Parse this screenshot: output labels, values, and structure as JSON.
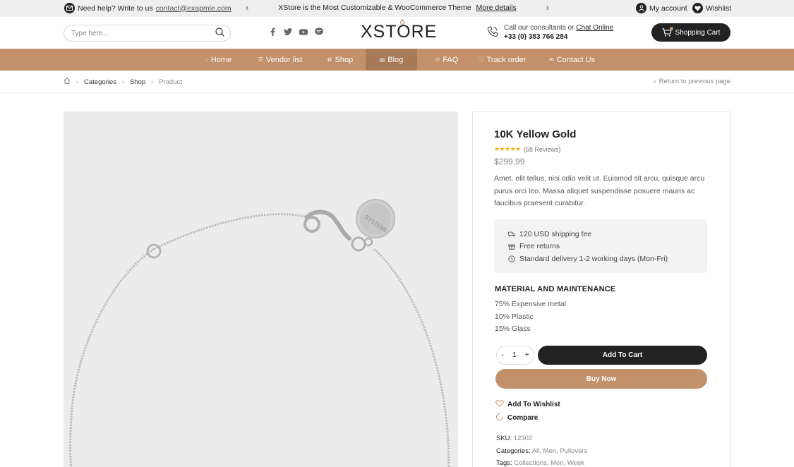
{
  "topbar": {
    "help_text": "Need help? Write to us",
    "help_email": "contact@exapmle.com",
    "promo_text": "XStore is the Most Customizable & WooCommerce Theme",
    "promo_link": "More details",
    "prev_arrow": "‹",
    "next_arrow": "›",
    "account_label": "My account",
    "wishlist_label": "Wishlist"
  },
  "header": {
    "search_placeholder": "Type here...",
    "logo_text": "XSTORE",
    "consult_text": "Call our consultants or",
    "chat_link": "Chat Online",
    "phone": "+33 (0) 383 766 284",
    "cart_label": "Shopping Cart",
    "socials": [
      "facebook-icon",
      "twitter-icon",
      "youtube-icon",
      "line-icon"
    ]
  },
  "nav": {
    "items": [
      {
        "label": "Home",
        "icon": "⌂"
      },
      {
        "label": "Vendor list",
        "icon": "☰"
      },
      {
        "label": "Shop",
        "icon": "✿"
      },
      {
        "label": "Blog",
        "icon": "▤"
      },
      {
        "label": "FAQ",
        "icon": "⊙"
      },
      {
        "label": "Track order",
        "icon": "ⓘ"
      },
      {
        "label": "Contact Us",
        "icon": "✉"
      }
    ],
    "active_index": 3,
    "accent_color": "#c2906a"
  },
  "breadcrumb": {
    "items": [
      "Categories",
      "Shop",
      "Product"
    ],
    "return_label": "Return to previous page"
  },
  "product": {
    "title": "10K Yellow Gold",
    "stars": "★★★★★",
    "reviews": "(58 Reviews)",
    "price": "$299,99",
    "description": "Amet, elit tellus, nisi odio velit ut. Euismod sit arcu, quisque arcu purus orci leo. Massa aliquet suspendisse posuere mauris ac faucibus praesent curabitur.",
    "shipping": [
      "120 USD shipping fee",
      "Free returns",
      "Standard delivery 1-2 working days (Mon-Fri)"
    ],
    "material_heading": "MATERIAL AND MAINTENANCE",
    "materials": [
      "75% Expensive metal",
      "10% Plastic",
      "15% Glass"
    ],
    "qty": {
      "minus": "-",
      "value": "1",
      "plus": "+"
    },
    "add_to_cart": "Add To Cart",
    "buy_now": "Buy Now",
    "add_to_wishlist": "Add To Wishlist",
    "compare": "Compare",
    "sku_label": "SKU:",
    "sku_value": "12302",
    "categories_label": "Categories:",
    "categories_value": "All, Men, Pullovers",
    "tags_label": "Tags:",
    "tags_value": "Collections, Men, Week",
    "charm_text": "SYSTEME"
  }
}
